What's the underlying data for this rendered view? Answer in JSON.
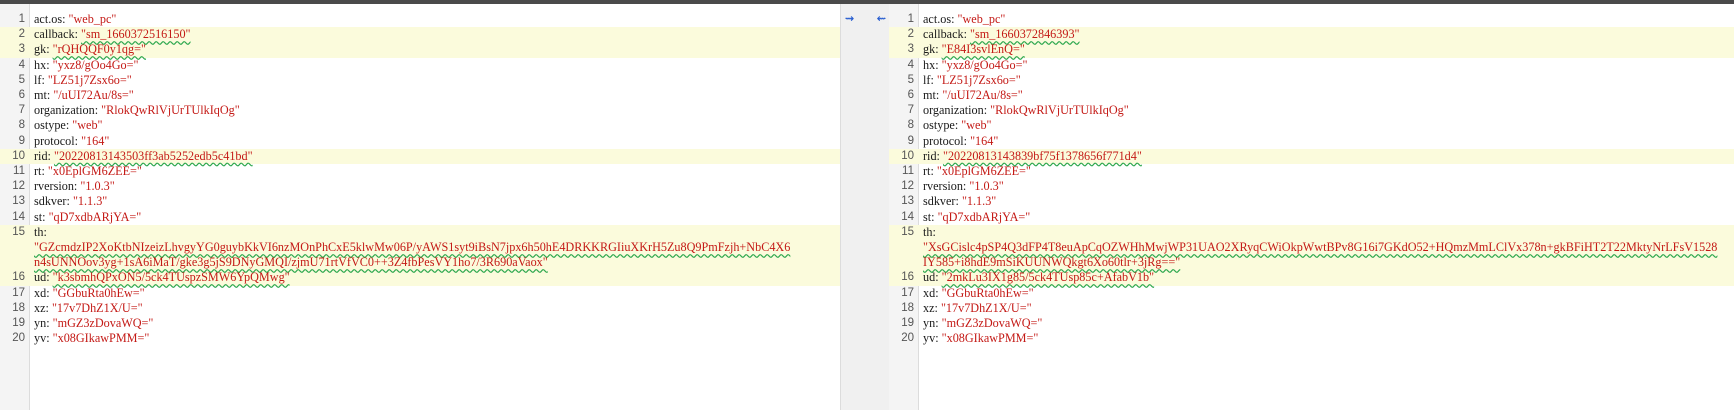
{
  "left": {
    "lines": [
      {
        "n": "1",
        "key": "act.os:",
        "val": "\"web_pc\"",
        "changed": false
      },
      {
        "n": "2",
        "key": "callback:",
        "val": "\"sm_1660372516150\"",
        "changed": true
      },
      {
        "n": "3",
        "key": "gk:",
        "val": "\"rQHQQF0y1qg=\"",
        "changed": true
      },
      {
        "n": "4",
        "key": "hx:",
        "val": "\"yxz8/gOo4Go=\"",
        "changed": false
      },
      {
        "n": "5",
        "key": "lf:",
        "val": "\"LZ51j7Zsx6o=\"",
        "changed": false
      },
      {
        "n": "6",
        "key": "mt:",
        "val": "\"/uUI72Au/8s=\"",
        "changed": false
      },
      {
        "n": "7",
        "key": "organization:",
        "val": "\"RlokQwRlVjUrTUlkIqOg\"",
        "changed": false
      },
      {
        "n": "8",
        "key": "ostype:",
        "val": "\"web\"",
        "changed": false
      },
      {
        "n": "9",
        "key": "protocol:",
        "val": "\"164\"",
        "changed": false
      },
      {
        "n": "10",
        "key": "rid:",
        "val": "\"20220813143503ff3ab5252edb5c41bd\"",
        "changed": true
      },
      {
        "n": "11",
        "key": "rt:",
        "val": "\"x0EplGM6ZEE=\"",
        "changed": false
      },
      {
        "n": "12",
        "key": "rversion:",
        "val": "\"1.0.3\"",
        "changed": false
      },
      {
        "n": "13",
        "key": "sdkver:",
        "val": "\"1.1.3\"",
        "changed": false
      },
      {
        "n": "14",
        "key": "st:",
        "val": "\"qD7xdbARjYA=\"",
        "changed": false
      },
      {
        "n": "15",
        "key": "th:",
        "val": "\"GZcmdzIP2XoKtbNIzeizLhvgyYG0guybKkVI6nzMOnPhCxE5klwMw06P/yAWS1syt9iBsN7jpx6h50hE4DRKKRGIiuXKrH5Zu8Q9PmFzjh+NbC4X6",
        "val2": "n4sUNNOov3yg+1sA6iMaT/gke3g5jS9DNyGMQI/zjmU71rtVfVC0++3Z4fbPesVY1ho7/3R690aVaox\"",
        "changed": true
      },
      {
        "n": "16",
        "key": "ud:",
        "val": "\"k3sbmhQPxON5/5ck4TUspzSMW6YpQMwg\"",
        "changed": true
      },
      {
        "n": "17",
        "key": "xd:",
        "val": "\"GGbuRta0hEw=\"",
        "changed": false
      },
      {
        "n": "18",
        "key": "xz:",
        "val": "\"17v7DhZ1X/U=\"",
        "changed": false
      },
      {
        "n": "19",
        "key": "yn:",
        "val": "\"mGZ3zDovaWQ=\"",
        "changed": false
      },
      {
        "n": "20",
        "key": "yv:",
        "val": "\"x08GIkawPMM=\"",
        "changed": false
      }
    ]
  },
  "right": {
    "lines": [
      {
        "n": "1",
        "key": "act.os:",
        "val": "\"web_pc\"",
        "changed": false
      },
      {
        "n": "2",
        "key": "callback:",
        "val": "\"sm_1660372846393\"",
        "changed": true
      },
      {
        "n": "3",
        "key": "gk:",
        "val": "\"E84I3svlEnQ=\"",
        "changed": true
      },
      {
        "n": "4",
        "key": "hx:",
        "val": "\"yxz8/gOo4Go=\"",
        "changed": false
      },
      {
        "n": "5",
        "key": "lf:",
        "val": "\"LZ51j7Zsx6o=\"",
        "changed": false
      },
      {
        "n": "6",
        "key": "mt:",
        "val": "\"/uUI72Au/8s=\"",
        "changed": false
      },
      {
        "n": "7",
        "key": "organization:",
        "val": "\"RlokQwRlVjUrTUlkIqOg\"",
        "changed": false
      },
      {
        "n": "8",
        "key": "ostype:",
        "val": "\"web\"",
        "changed": false
      },
      {
        "n": "9",
        "key": "protocol:",
        "val": "\"164\"",
        "changed": false
      },
      {
        "n": "10",
        "key": "rid:",
        "val": "\"20220813143839bf75f1378656f771d4\"",
        "changed": true
      },
      {
        "n": "11",
        "key": "rt:",
        "val": "\"x0EplGM6ZEE=\"",
        "changed": false
      },
      {
        "n": "12",
        "key": "rversion:",
        "val": "\"1.0.3\"",
        "changed": false
      },
      {
        "n": "13",
        "key": "sdkver:",
        "val": "\"1.1.3\"",
        "changed": false
      },
      {
        "n": "14",
        "key": "st:",
        "val": "\"qD7xdbARjYA=\"",
        "changed": false
      },
      {
        "n": "15",
        "key": "th:",
        "val": "\"XsGCislc4pSP4Q3dFP4T8euApCqOZWHhMwjWP31UAO2XRyqCWiOkpWwtBPv8G16i7GKdO52+HQmzMmLClVx378n+gkBFiHT2T22MktyNrLFsV1528",
        "val2": "IY585+i8hdE9mSiKUUNWQkgt6Xo60tlr+3jRg==\"",
        "changed": true
      },
      {
        "n": "16",
        "key": "ud:",
        "val": "\"2mkLu3IX1g85/5ck4TUsp85c+AfabV1b\"",
        "changed": true
      },
      {
        "n": "17",
        "key": "xd:",
        "val": "\"GGbuRta0hEw=\"",
        "changed": false
      },
      {
        "n": "18",
        "key": "xz:",
        "val": "\"17v7DhZ1X/U=\"",
        "changed": false
      },
      {
        "n": "19",
        "key": "yn:",
        "val": "\"mGZ3zDovaWQ=\"",
        "changed": false
      },
      {
        "n": "20",
        "key": "yv:",
        "val": "\"x08GIkawPMM=\"",
        "changed": false
      }
    ]
  },
  "merge_controls": {
    "copy_right_label": "⇝",
    "copy_left_label": "⇜"
  }
}
